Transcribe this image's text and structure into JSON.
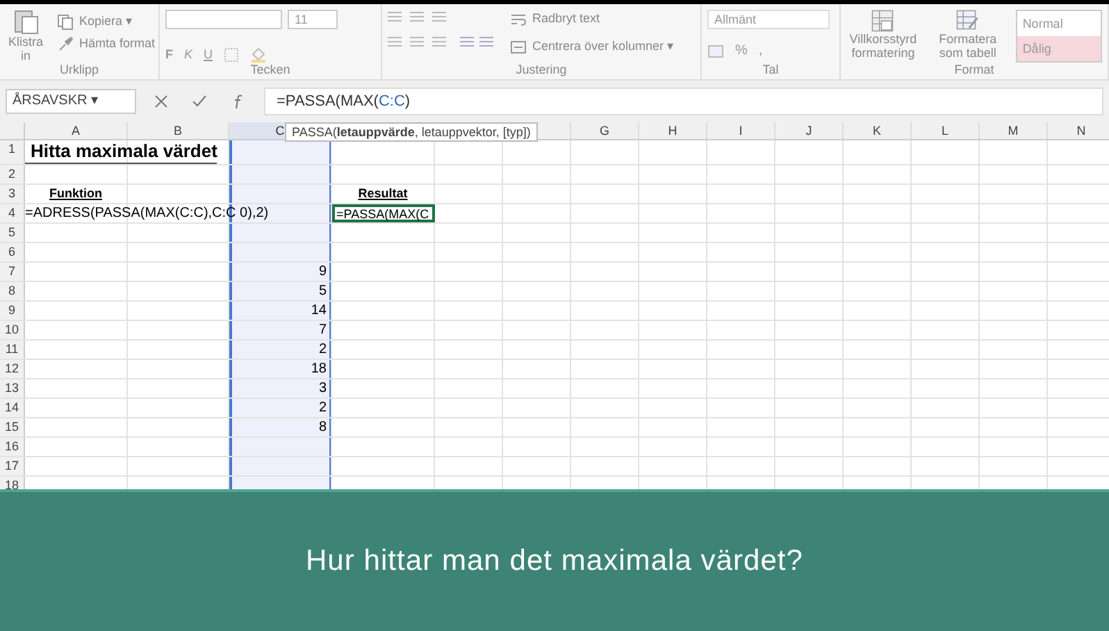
{
  "ribbon": {
    "groups": [
      {
        "label": "Urklipp",
        "items": [
          {
            "kind": "big",
            "label": "Klistra in"
          },
          {
            "kind": "small",
            "label": "Kopiera",
            "arrow": "▾"
          },
          {
            "kind": "small",
            "label": "Hämta format"
          }
        ]
      },
      {
        "label": "Tecken",
        "items": [
          {
            "kind": "font",
            "size": "11"
          },
          {
            "kind": "format",
            "buttons": [
              "F",
              "K",
              "U"
            ]
          }
        ]
      },
      {
        "label": "Justering",
        "items": [
          {
            "kind": "align"
          },
          {
            "kind": "small",
            "label": "Radbryt text"
          },
          {
            "kind": "small",
            "label": "Centrera över kolumner",
            "arrow": "▾"
          }
        ]
      },
      {
        "label": "Tal",
        "items": [
          {
            "kind": "number",
            "format": "Allmänt",
            "percent": "%",
            "comma": ","
          }
        ]
      },
      {
        "label": "Format",
        "items": [
          {
            "kind": "big",
            "label": "Villkorsstyrd formatering"
          },
          {
            "kind": "big",
            "label": "Formatera som tabell"
          },
          {
            "kind": "styles",
            "styles": [
              {
                "label": "Normal",
                "color": "#ffffff"
              },
              {
                "label": "Dålig",
                "color": "#f5d7dc"
              }
            ]
          }
        ]
      }
    ]
  },
  "name_box": {
    "value": "ÅRSAVSKR",
    "arrow": "▾"
  },
  "formula": [
    {
      "text": "=PASSA(MAX(",
      "color": "#333333"
    },
    {
      "text": "C:C",
      "color": "#2f62c0"
    },
    {
      "text": ")",
      "color": "#333333"
    }
  ],
  "tooltip": "PASSA(**letauppvärde**, letauppvektor, [typ])",
  "columns": [
    {
      "label": "A",
      "kind": "plain"
    },
    {
      "label": "B",
      "kind": "plain"
    },
    {
      "label": "C",
      "kind": "referenced"
    },
    {
      "kind": "plain"
    },
    {
      "kind": "plain"
    },
    {
      "kind": "plain"
    },
    {
      "label": "G",
      "kind": "plain"
    },
    {
      "label": "H",
      "kind": "plain"
    },
    {
      "label": "I",
      "kind": "plain"
    },
    {
      "label": "J",
      "kind": "plain"
    },
    {
      "label": "K",
      "kind": "plain"
    },
    {
      "label": "L",
      "kind": "plain"
    },
    {
      "label": "M",
      "kind": "plain"
    },
    {
      "label": "N",
      "kind": "plain"
    }
  ],
  "rows": [
    {
      "number": "1",
      "cells": {
        "A": {
          "kind": "title",
          "text": "Hitta maximala värdet"
        }
      }
    },
    {
      "number": "2",
      "cells": {}
    },
    {
      "number": "3",
      "cells": {
        "A": {
          "kind": "heading",
          "text": "Funktion"
        },
        "D": {
          "kind": "heading",
          "text": "Resultat"
        }
      }
    },
    {
      "number": "4",
      "cells": {
        "A": {
          "kind": "formula",
          "text": "=ADRESS(PASSA(MAX(C:C),C:C 0),2)"
        },
        "D": {
          "kind": "active",
          "text": "=PASSA(MAX(C"
        }
      }
    },
    {
      "number": "5",
      "cells": {}
    },
    {
      "number": "6",
      "cells": {}
    },
    {
      "number": "7",
      "cells": {
        "C": {
          "kind": "number",
          "text": "9"
        }
      }
    },
    {
      "number": "8",
      "cells": {
        "C": {
          "kind": "number",
          "text": "5"
        }
      }
    },
    {
      "number": "9",
      "cells": {
        "C": {
          "kind": "number",
          "text": "14"
        }
      }
    },
    {
      "number": "10",
      "cells": {
        "C": {
          "kind": "number",
          "text": "7"
        }
      }
    },
    {
      "number": "11",
      "cells": {
        "C": {
          "kind": "number",
          "text": "2"
        }
      }
    },
    {
      "number": "12",
      "cells": {
        "C": {
          "kind": "number",
          "text": "18"
        }
      }
    },
    {
      "number": "13",
      "cells": {
        "C": {
          "kind": "number",
          "text": "3"
        }
      }
    },
    {
      "number": "14",
      "cells": {
        "C": {
          "kind": "number",
          "text": "2"
        }
      }
    },
    {
      "number": "15",
      "cells": {
        "C": {
          "kind": "number",
          "text": "8"
        }
      }
    },
    {
      "number": "16",
      "cells": {}
    },
    {
      "number": "17",
      "cells": {}
    },
    {
      "number": "18",
      "cells": {}
    }
  ],
  "banner": {
    "text": "Hur hittar man det maximala värdet?"
  }
}
